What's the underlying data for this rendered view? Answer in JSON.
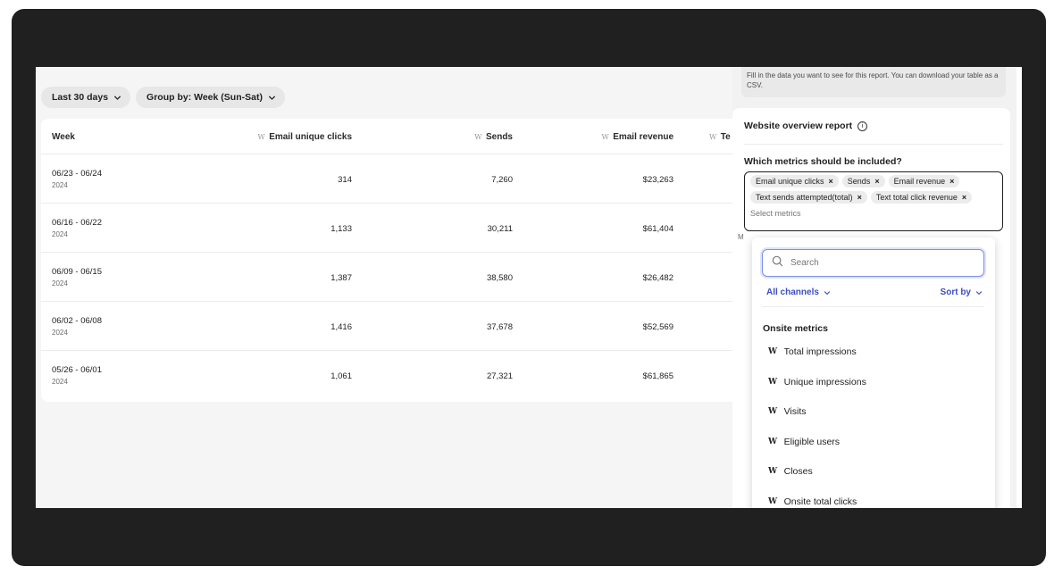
{
  "filters": {
    "range_label": "Last 30 days",
    "group_label": "Group by: Week (Sun-Sat)"
  },
  "table": {
    "headers": {
      "week": "Week",
      "clicks": "Email unique clicks",
      "sends": "Sends",
      "revenue": "Email revenue",
      "partial": "Te"
    },
    "rows": [
      {
        "week": "06/23 - 06/24",
        "year": "2024",
        "clicks": "314",
        "sends": "7,260",
        "revenue": "$23,263"
      },
      {
        "week": "06/16 - 06/22",
        "year": "2024",
        "clicks": "1,133",
        "sends": "30,211",
        "revenue": "$61,404"
      },
      {
        "week": "06/09 - 06/15",
        "year": "2024",
        "clicks": "1,387",
        "sends": "38,580",
        "revenue": "$26,482"
      },
      {
        "week": "06/02 - 06/08",
        "year": "2024",
        "clicks": "1,416",
        "sends": "37,678",
        "revenue": "$52,569"
      },
      {
        "week": "05/26 - 06/01",
        "year": "2024",
        "clicks": "1,061",
        "sends": "27,321",
        "revenue": "$61,865"
      }
    ]
  },
  "panel": {
    "info_text": "Fill in the data you want to see for this report. You can download your table as a CSV.",
    "report_title": "Website overview report",
    "question": "Which metrics should be included?",
    "chips": [
      "Email unique clicks",
      "Sends",
      "Email revenue",
      "Text sends attempted(total)",
      "Text total click revenue"
    ],
    "select_placeholder": "Select metrics",
    "trail_letter": "M"
  },
  "dropdown": {
    "search_placeholder": "Search",
    "channels_label": "All channels",
    "sort_label": "Sort by",
    "group_title": "Onsite metrics",
    "options": [
      "Total impressions",
      "Unique impressions",
      "Visits",
      "Eligible users",
      "Closes",
      "Onsite total clicks"
    ]
  },
  "icons": {
    "metric_logo": "W",
    "chip_remove": "×",
    "info": "i"
  },
  "colors": {
    "accent": "#3b4fc4",
    "frame": "#202020"
  }
}
